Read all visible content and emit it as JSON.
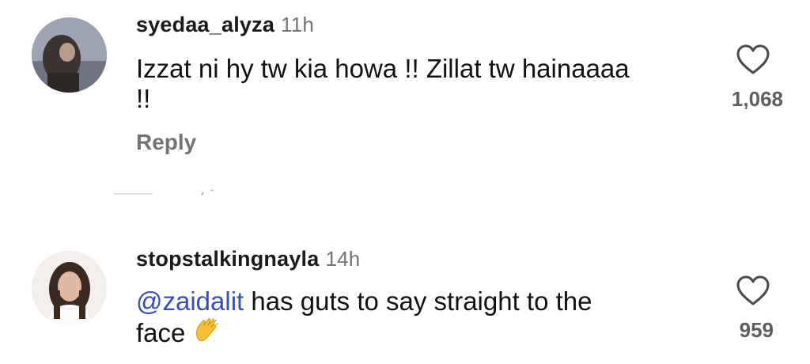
{
  "comments": [
    {
      "username": "syedaa_alyza",
      "time": "11h",
      "text": "Izzat ni hy tw kia howa !! Zillat tw hainaaaa !!",
      "reply_label": "Reply",
      "like_count": "1,068"
    },
    {
      "username": "stopstalkingnayla",
      "time": "14h",
      "mention": "@zaidalit",
      "text": " has guts to say straight to the face",
      "emoji": "clapping-hands",
      "like_count": "959"
    }
  ],
  "icons": {
    "like": "heart-outline-icon"
  },
  "colors": {
    "mention": "#3a4fb5",
    "muted": "#737373",
    "count": "#5f5f5f"
  }
}
